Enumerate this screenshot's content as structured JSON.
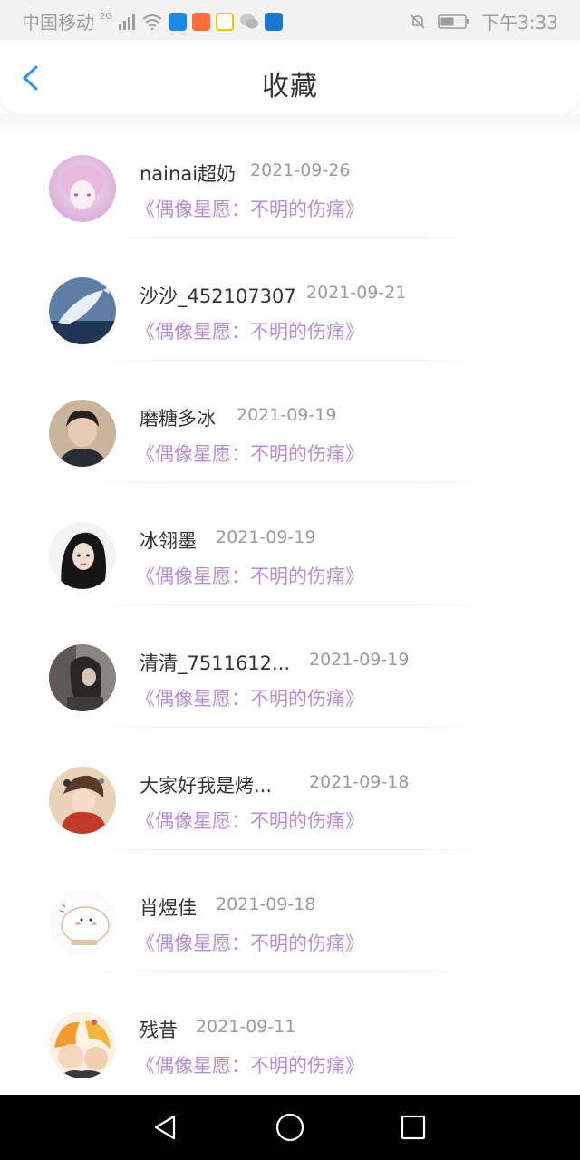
{
  "status_bar": {
    "carrier": "中国移动",
    "network": "2G",
    "time": "下午3:33"
  },
  "header": {
    "title": "收藏"
  },
  "favorites": [
    {
      "name": "nainai超奶",
      "date": "2021-09-26",
      "title": "《偶像星愿：不明的伤痛》"
    },
    {
      "name": "沙沙_452107307",
      "date": "2021-09-21",
      "title": "《偶像星愿：不明的伤痛》"
    },
    {
      "name": "磨糖多冰",
      "date": "2021-09-19",
      "title": "《偶像星愿：不明的伤痛》"
    },
    {
      "name": "冰翎墨",
      "date": "2021-09-19",
      "title": "《偶像星愿：不明的伤痛》"
    },
    {
      "name": "清清_7511612...",
      "date": "2021-09-19",
      "title": "《偶像星愿：不明的伤痛》"
    },
    {
      "name": "大家好我是烤...",
      "date": "2021-09-18",
      "title": "《偶像星愿：不明的伤痛》"
    },
    {
      "name": "肖煜佳",
      "date": "2021-09-18",
      "title": "《偶像星愿：不明的伤痛》"
    },
    {
      "name": "残昔",
      "date": "2021-09-11",
      "title": "《偶像星愿：不明的伤痛》"
    }
  ],
  "colors": {
    "accent": "#2196f3",
    "link_purple": "#b98ed6",
    "date_gray": "#9b9b9b"
  },
  "icons": {
    "back": "chevron-left-icon",
    "nav_back": "triangle-back-icon",
    "nav_home": "circle-home-icon",
    "nav_recents": "square-recents-icon"
  }
}
